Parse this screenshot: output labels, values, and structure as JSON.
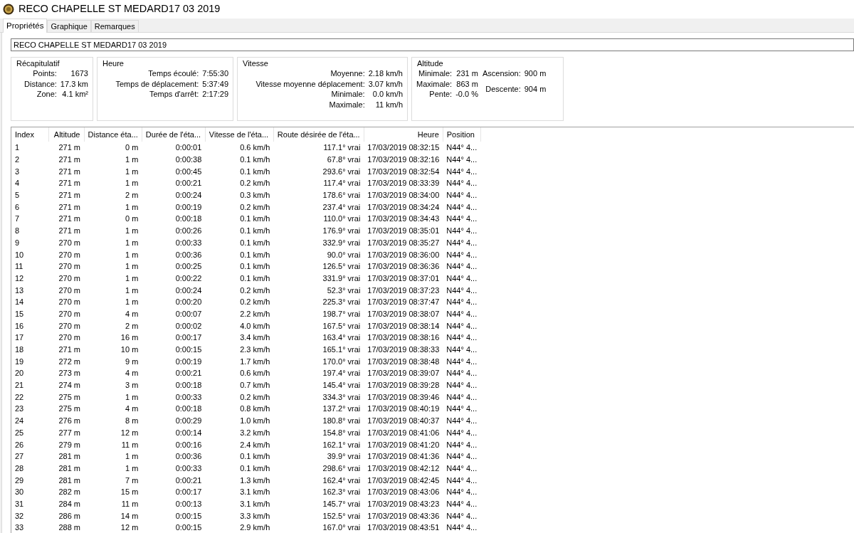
{
  "window": {
    "title": "RECO CHAPELLE ST MEDARD17 03 2019"
  },
  "tabs": [
    {
      "label": "Propriétés",
      "selected": true
    },
    {
      "label": "Graphique",
      "selected": false
    },
    {
      "label": "Remarques",
      "selected": false
    }
  ],
  "name_field": {
    "value": "RECO CHAPELLE ST MEDARD17 03 2019"
  },
  "groups": [
    {
      "title": "Récapitulatif",
      "columns": [
        [
          {
            "label": "Points:",
            "value": "1673"
          },
          {
            "label": "Distance:",
            "value": "17.3 km"
          },
          {
            "label": "Zone:",
            "value": "4.1 km²"
          }
        ]
      ]
    },
    {
      "title": "Heure",
      "columns": [
        [
          {
            "label": "Temps écoulé:",
            "value": "7:55:30"
          },
          {
            "label": "Temps de déplacement:",
            "value": "5:37:49"
          },
          {
            "label": "Temps d'arrêt:",
            "value": "2:17:29"
          }
        ]
      ]
    },
    {
      "title": "Vitesse",
      "columns": [
        [
          {
            "label": "Moyenne:",
            "value": "2.18 km/h"
          },
          {
            "label": "Vitesse moyenne déplacement:",
            "value": "3.07 km/h"
          },
          {
            "label": "Minimale:",
            "value": "0.0 km/h"
          },
          {
            "label": "Maximale:",
            "value": "11 km/h"
          }
        ]
      ]
    },
    {
      "title": "Altitude",
      "columns": [
        [
          {
            "label": "Minimale:",
            "value": "231 m"
          },
          {
            "label": "Maximale:",
            "value": "863 m"
          },
          {
            "label": "Pente:",
            "value": "-0.0 %"
          }
        ],
        [
          {
            "label": "Ascension:",
            "value": "900 m"
          },
          {
            "label": "Descente:",
            "value": "904 m"
          }
        ]
      ]
    }
  ],
  "table": {
    "columns": [
      "Index",
      "Altitude",
      "Distance éta...",
      "Durée de l'éta...",
      "Vitesse de l'éta...",
      "Route désirée de l'éta...",
      "Heure",
      "Position"
    ],
    "rows": [
      [
        "1",
        "271 m",
        "0 m",
        "0:00:01",
        "0.6 km/h",
        "117.1° vrai",
        "17/03/2019 08:32:15",
        "N44° 4..."
      ],
      [
        "2",
        "271 m",
        "1 m",
        "0:00:38",
        "0.1 km/h",
        "67.8° vrai",
        "17/03/2019 08:32:16",
        "N44° 4..."
      ],
      [
        "3",
        "271 m",
        "1 m",
        "0:00:45",
        "0.1 km/h",
        "293.6° vrai",
        "17/03/2019 08:32:54",
        "N44° 4..."
      ],
      [
        "4",
        "271 m",
        "1 m",
        "0:00:21",
        "0.2 km/h",
        "117.4° vrai",
        "17/03/2019 08:33:39",
        "N44° 4..."
      ],
      [
        "5",
        "271 m",
        "2 m",
        "0:00:24",
        "0.3 km/h",
        "178.6° vrai",
        "17/03/2019 08:34:00",
        "N44° 4..."
      ],
      [
        "6",
        "271 m",
        "1 m",
        "0:00:19",
        "0.2 km/h",
        "237.4° vrai",
        "17/03/2019 08:34:24",
        "N44° 4..."
      ],
      [
        "7",
        "271 m",
        "0 m",
        "0:00:18",
        "0.1 km/h",
        "110.0° vrai",
        "17/03/2019 08:34:43",
        "N44° 4..."
      ],
      [
        "8",
        "271 m",
        "1 m",
        "0:00:26",
        "0.1 km/h",
        "176.9° vrai",
        "17/03/2019 08:35:01",
        "N44° 4..."
      ],
      [
        "9",
        "270 m",
        "1 m",
        "0:00:33",
        "0.1 km/h",
        "332.9° vrai",
        "17/03/2019 08:35:27",
        "N44° 4..."
      ],
      [
        "10",
        "270 m",
        "1 m",
        "0:00:36",
        "0.1 km/h",
        "90.0° vrai",
        "17/03/2019 08:36:00",
        "N44° 4..."
      ],
      [
        "11",
        "270 m",
        "1 m",
        "0:00:25",
        "0.1 km/h",
        "126.5° vrai",
        "17/03/2019 08:36:36",
        "N44° 4..."
      ],
      [
        "12",
        "270 m",
        "1 m",
        "0:00:22",
        "0.1 km/h",
        "331.9° vrai",
        "17/03/2019 08:37:01",
        "N44° 4..."
      ],
      [
        "13",
        "270 m",
        "1 m",
        "0:00:24",
        "0.2 km/h",
        "52.3° vrai",
        "17/03/2019 08:37:23",
        "N44° 4..."
      ],
      [
        "14",
        "270 m",
        "1 m",
        "0:00:20",
        "0.2 km/h",
        "225.3° vrai",
        "17/03/2019 08:37:47",
        "N44° 4..."
      ],
      [
        "15",
        "270 m",
        "4 m",
        "0:00:07",
        "2.2 km/h",
        "198.7° vrai",
        "17/03/2019 08:38:07",
        "N44° 4..."
      ],
      [
        "16",
        "270 m",
        "2 m",
        "0:00:02",
        "4.0 km/h",
        "167.5° vrai",
        "17/03/2019 08:38:14",
        "N44° 4..."
      ],
      [
        "17",
        "270 m",
        "16 m",
        "0:00:17",
        "3.4 km/h",
        "163.4° vrai",
        "17/03/2019 08:38:16",
        "N44° 4..."
      ],
      [
        "18",
        "271 m",
        "10 m",
        "0:00:15",
        "2.3 km/h",
        "165.1° vrai",
        "17/03/2019 08:38:33",
        "N44° 4..."
      ],
      [
        "19",
        "272 m",
        "9 m",
        "0:00:19",
        "1.7 km/h",
        "170.0° vrai",
        "17/03/2019 08:38:48",
        "N44° 4..."
      ],
      [
        "20",
        "273 m",
        "4 m",
        "0:00:21",
        "0.6 km/h",
        "197.4° vrai",
        "17/03/2019 08:39:07",
        "N44° 4..."
      ],
      [
        "21",
        "274 m",
        "3 m",
        "0:00:18",
        "0.7 km/h",
        "145.4° vrai",
        "17/03/2019 08:39:28",
        "N44° 4..."
      ],
      [
        "22",
        "275 m",
        "1 m",
        "0:00:33",
        "0.2 km/h",
        "334.3° vrai",
        "17/03/2019 08:39:46",
        "N44° 4..."
      ],
      [
        "23",
        "275 m",
        "4 m",
        "0:00:18",
        "0.8 km/h",
        "137.2° vrai",
        "17/03/2019 08:40:19",
        "N44° 4..."
      ],
      [
        "24",
        "276 m",
        "8 m",
        "0:00:29",
        "1.0 km/h",
        "180.8° vrai",
        "17/03/2019 08:40:37",
        "N44° 4..."
      ],
      [
        "25",
        "277 m",
        "12 m",
        "0:00:14",
        "3.2 km/h",
        "154.8° vrai",
        "17/03/2019 08:41:06",
        "N44° 4..."
      ],
      [
        "26",
        "279 m",
        "11 m",
        "0:00:16",
        "2.4 km/h",
        "162.1° vrai",
        "17/03/2019 08:41:20",
        "N44° 4..."
      ],
      [
        "27",
        "281 m",
        "1 m",
        "0:00:36",
        "0.1 km/h",
        "39.9° vrai",
        "17/03/2019 08:41:36",
        "N44° 4..."
      ],
      [
        "28",
        "281 m",
        "1 m",
        "0:00:33",
        "0.1 km/h",
        "298.6° vrai",
        "17/03/2019 08:42:12",
        "N44° 4..."
      ],
      [
        "29",
        "281 m",
        "7 m",
        "0:00:21",
        "1.3 km/h",
        "162.4° vrai",
        "17/03/2019 08:42:45",
        "N44° 4..."
      ],
      [
        "30",
        "282 m",
        "15 m",
        "0:00:17",
        "3.1 km/h",
        "162.3° vrai",
        "17/03/2019 08:43:06",
        "N44° 4..."
      ],
      [
        "31",
        "284 m",
        "11 m",
        "0:00:13",
        "3.1 km/h",
        "145.7° vrai",
        "17/03/2019 08:43:23",
        "N44° 4..."
      ],
      [
        "32",
        "286 m",
        "14 m",
        "0:00:15",
        "3.3 km/h",
        "152.5° vrai",
        "17/03/2019 08:43:36",
        "N44° 4..."
      ],
      [
        "33",
        "288 m",
        "12 m",
        "0:00:15",
        "2.9 km/h",
        "167.0° vrai",
        "17/03/2019 08:43:51",
        "N44° 4..."
      ]
    ]
  }
}
